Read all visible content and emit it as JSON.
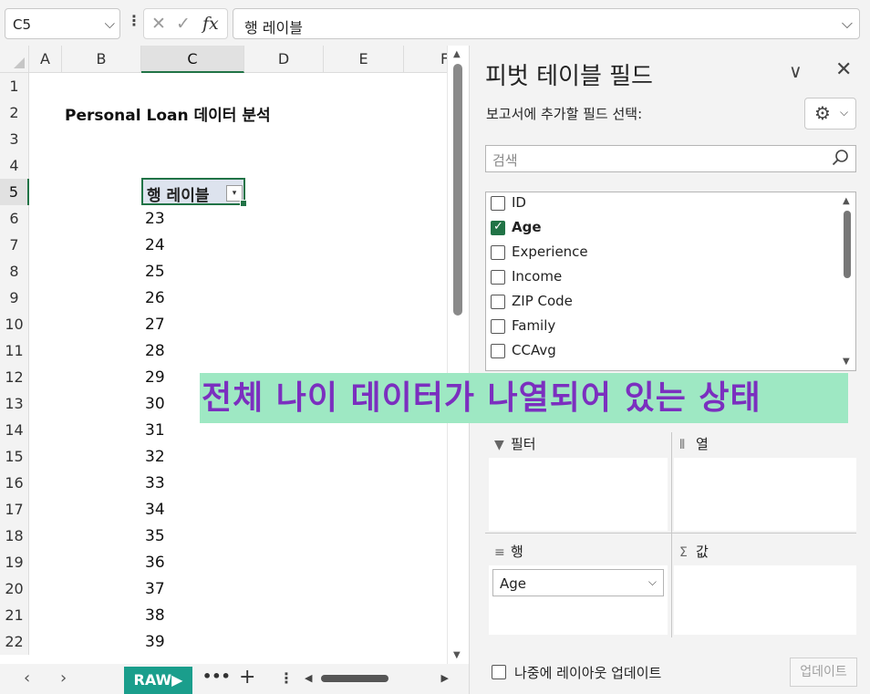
{
  "formula_bar": {
    "name_box": "C5",
    "formula": "행 레이블"
  },
  "sheet": {
    "columns": [
      "A",
      "B",
      "C",
      "D",
      "E",
      "F"
    ],
    "rows": [
      "1",
      "2",
      "3",
      "4",
      "5",
      "6",
      "7",
      "8",
      "9",
      "10",
      "11",
      "12",
      "13",
      "14",
      "15",
      "16",
      "17",
      "18",
      "19",
      "20",
      "21",
      "22"
    ],
    "title": "Personal Loan 데이터 분석",
    "pivot_header": "행 레이블",
    "ages": [
      "23",
      "24",
      "25",
      "26",
      "27",
      "28",
      "29",
      "30",
      "31",
      "32",
      "33",
      "34",
      "35",
      "36",
      "37",
      "38",
      "39"
    ]
  },
  "sheet_bar": {
    "tab_label": "RAW▶",
    "more": "•••",
    "add": "+"
  },
  "pivot_panel": {
    "title": "피벗 테이블 필드",
    "subtitle": "보고서에 추가할 필드 선택:",
    "search_placeholder": "검색",
    "fields": [
      {
        "label": "ID",
        "checked": false
      },
      {
        "label": "Age",
        "checked": true
      },
      {
        "label": "Experience",
        "checked": false
      },
      {
        "label": "Income",
        "checked": false
      },
      {
        "label": "ZIP Code",
        "checked": false
      },
      {
        "label": "Family",
        "checked": false
      },
      {
        "label": "CCAvg",
        "checked": false
      }
    ],
    "areas": {
      "filters": "필터",
      "columns": "열",
      "rows": "행",
      "values": "값"
    },
    "row_field": "Age",
    "defer_label": "나중에 레이아웃 업데이트",
    "update_button": "업데이트"
  },
  "annotation": "전체 나이 데이터가 나열되어 있는 상태",
  "colors": {
    "accent": "#217346",
    "sheet_tab": "#1a9e8c",
    "annotation_bg": "#9ee8c3",
    "annotation_text": "#7b2fbf"
  }
}
